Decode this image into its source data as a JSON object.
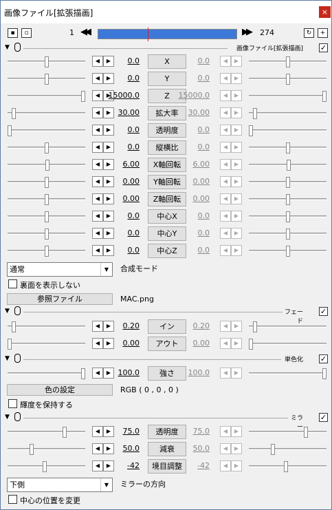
{
  "window": {
    "title": "画像ファイル[拡張描画]",
    "close": "×"
  },
  "timeline": {
    "start": "1",
    "end": "274",
    "position_fraction": 0.36
  },
  "sections": [
    {
      "label": "画像ファイル[拡張描画]",
      "checked": true
    },
    {
      "label": "フェード",
      "checked": true
    },
    {
      "label": "単色化",
      "checked": true
    },
    {
      "label": "ミラー",
      "checked": true
    }
  ],
  "main_params": [
    {
      "name": "X",
      "value": "0.0",
      "end": "0.0",
      "thumb": 0.5,
      "thumb_r": 0.5
    },
    {
      "name": "Y",
      "value": "0.0",
      "end": "0.0",
      "thumb": 0.5,
      "thumb_r": 0.5
    },
    {
      "name": "Z",
      "value": "15000.0",
      "end": "15000.0",
      "thumb": 1.0,
      "thumb_r": 1.0
    },
    {
      "name": "拡大率",
      "value": "30.00",
      "end": "30.00",
      "thumb": 0.06,
      "thumb_r": 0.06
    },
    {
      "name": "透明度",
      "value": "0.0",
      "end": "0.0",
      "thumb": 0.0,
      "thumb_r": 0.0
    },
    {
      "name": "縦横比",
      "value": "0.0",
      "end": "0.0",
      "thumb": 0.5,
      "thumb_r": 0.5
    },
    {
      "name": "X軸回転",
      "value": "6.00",
      "end": "6.00",
      "thumb": 0.51,
      "thumb_r": 0.51
    },
    {
      "name": "Y軸回転",
      "value": "0.00",
      "end": "0.00",
      "thumb": 0.5,
      "thumb_r": 0.5
    },
    {
      "name": "Z軸回転",
      "value": "0.00",
      "end": "0.00",
      "thumb": 0.5,
      "thumb_r": 0.5
    },
    {
      "name": "中心X",
      "value": "0.0",
      "end": "0.0",
      "thumb": 0.5,
      "thumb_r": 0.5
    },
    {
      "name": "中心Y",
      "value": "0.0",
      "end": "0.0",
      "thumb": 0.5,
      "thumb_r": 0.5
    },
    {
      "name": "中心Z",
      "value": "0.0",
      "end": "0.0",
      "thumb": 0.5,
      "thumb_r": 0.5
    }
  ],
  "blend": {
    "value": "通常",
    "label": "合成モード"
  },
  "backface": {
    "label": "裏面を表示しない",
    "checked": false
  },
  "ref_file": {
    "button": "参照ファイル",
    "value": "MAC.png"
  },
  "fade_params": [
    {
      "name": "イン",
      "value": "0.20",
      "end": "0.20",
      "thumb": 0.06,
      "thumb_r": 0.06
    },
    {
      "name": "アウト",
      "value": "0.00",
      "end": "0.00",
      "thumb": 0.0,
      "thumb_r": 0.0
    }
  ],
  "mono_params": [
    {
      "name": "強さ",
      "value": "100.0",
      "end": "100.0",
      "thumb": 1.0,
      "thumb_r": 1.0
    }
  ],
  "color": {
    "button": "色の設定",
    "value": "RGB ( 0 , 0 , 0 )"
  },
  "keep_luma": {
    "label": "輝度を保持する",
    "checked": false
  },
  "mirror_params": [
    {
      "name": "透明度",
      "value": "75.0",
      "end": "75.0",
      "thumb": 0.75,
      "thumb_r": 0.75
    },
    {
      "name": "減衰",
      "value": "50.0",
      "end": "50.0",
      "thumb": 0.3,
      "thumb_r": 0.3
    },
    {
      "name": "境目調整",
      "value": "-42",
      "end": "-42",
      "thumb": 0.48,
      "thumb_r": 0.48
    }
  ],
  "mirror_dir": {
    "value": "下側",
    "label": "ミラーの方向"
  },
  "center_change": {
    "label": "中心の位置を変更",
    "checked": false
  }
}
